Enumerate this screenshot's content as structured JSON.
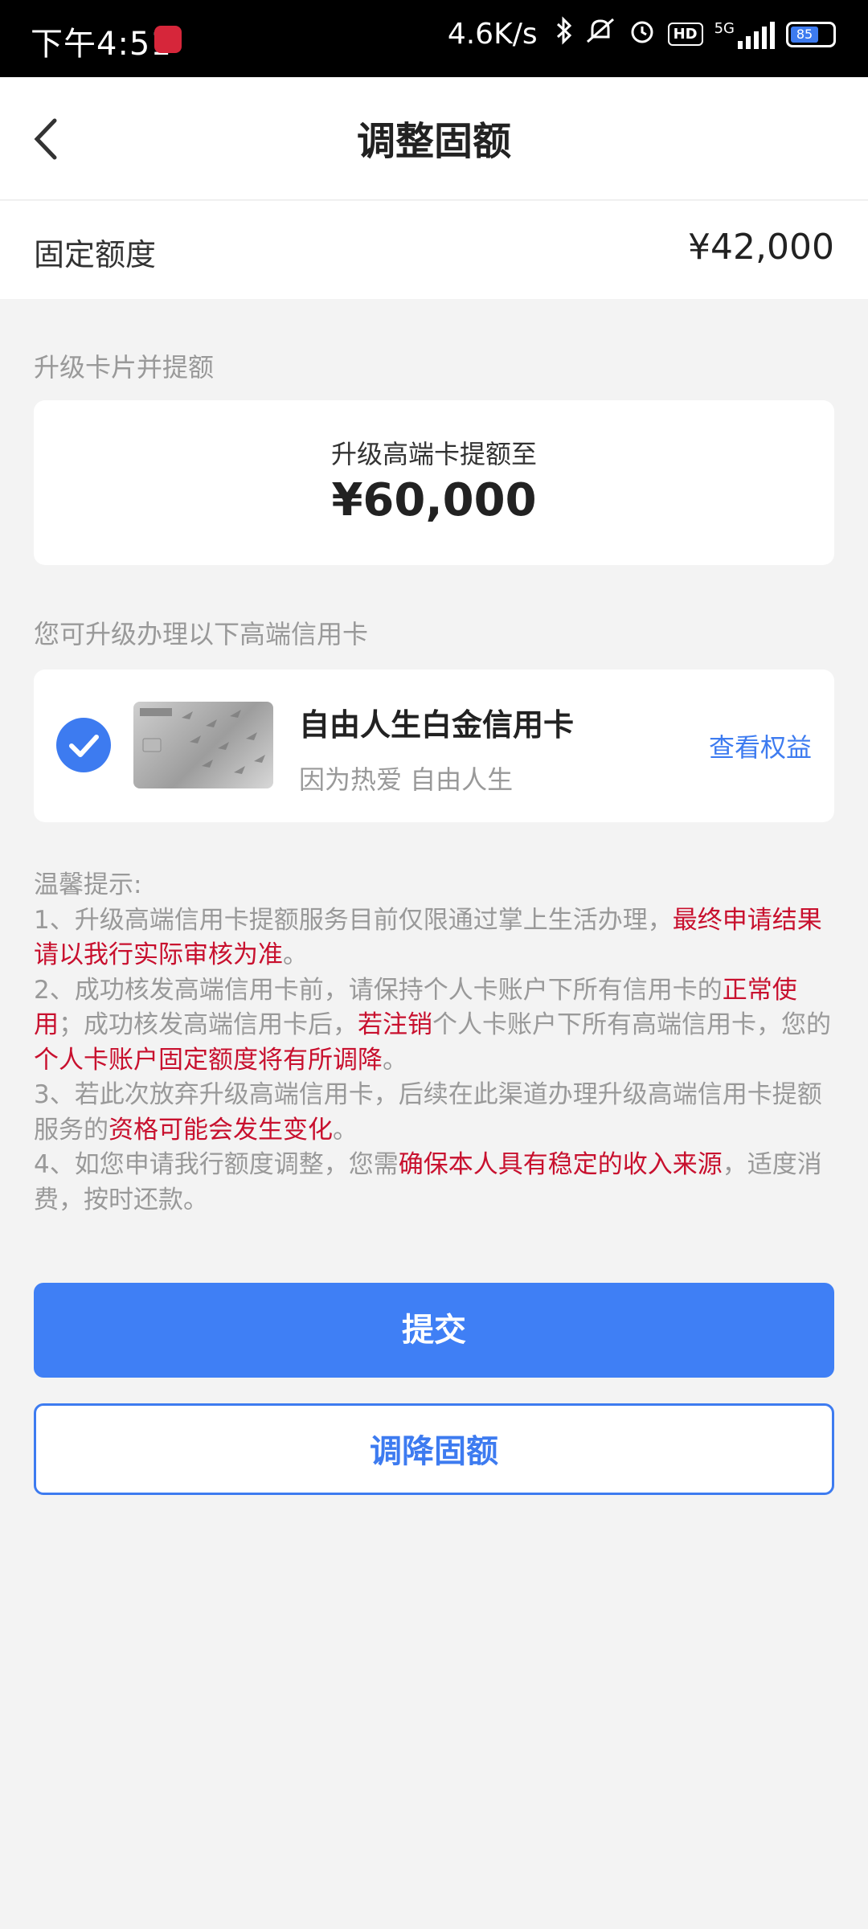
{
  "status_bar": {
    "time": "下午4:51",
    "net_speed": "4.6K/s",
    "network": "5G",
    "battery": "85"
  },
  "header": {
    "title": "调整固额"
  },
  "fixed_limit": {
    "label": "固定额度",
    "value": "¥42,000"
  },
  "upgrade_section": {
    "label": "升级卡片并提额",
    "subtitle": "升级高端卡提额至",
    "amount": "¥60,000"
  },
  "card_section": {
    "label": "您可升级办理以下高端信用卡",
    "card_name": "自由人生白金信用卡",
    "card_slogan": "因为热爱 自由人生",
    "benefit_link": "查看权益",
    "selected": true
  },
  "tips": {
    "title": "温馨提示:",
    "t1a": "1、升级高端信用卡提额服务目前仅限通过掌上生活办理，",
    "t1b": "最终申请结果请以我行实际审核为准",
    "t1c": "。",
    "t2a": "2、成功核发高端信用卡前，请保持个人卡账户下所有信用卡的",
    "t2b": "正常使用",
    "t2c": "；成功核发高端信用卡后，",
    "t2d": "若注销",
    "t2e": "个人卡账户下所有高端信用卡，您的",
    "t2f": "个人卡账户固定额度将有所调降",
    "t2g": "。",
    "t3a": "3、若此次放弃升级高端信用卡，后续在此渠道办理升级高端信用卡提额服务的",
    "t3b": "资格可能会发生变化",
    "t3c": "。",
    "t4a": "4、如您申请我行额度调整，您需",
    "t4b": "确保本人具有稳定的收入来源",
    "t4c": "，适度消费，按时还款。"
  },
  "buttons": {
    "submit": "提交",
    "lower": "调降固额"
  },
  "colors": {
    "accent": "#3F7FF5",
    "highlight": "#C8102E"
  }
}
